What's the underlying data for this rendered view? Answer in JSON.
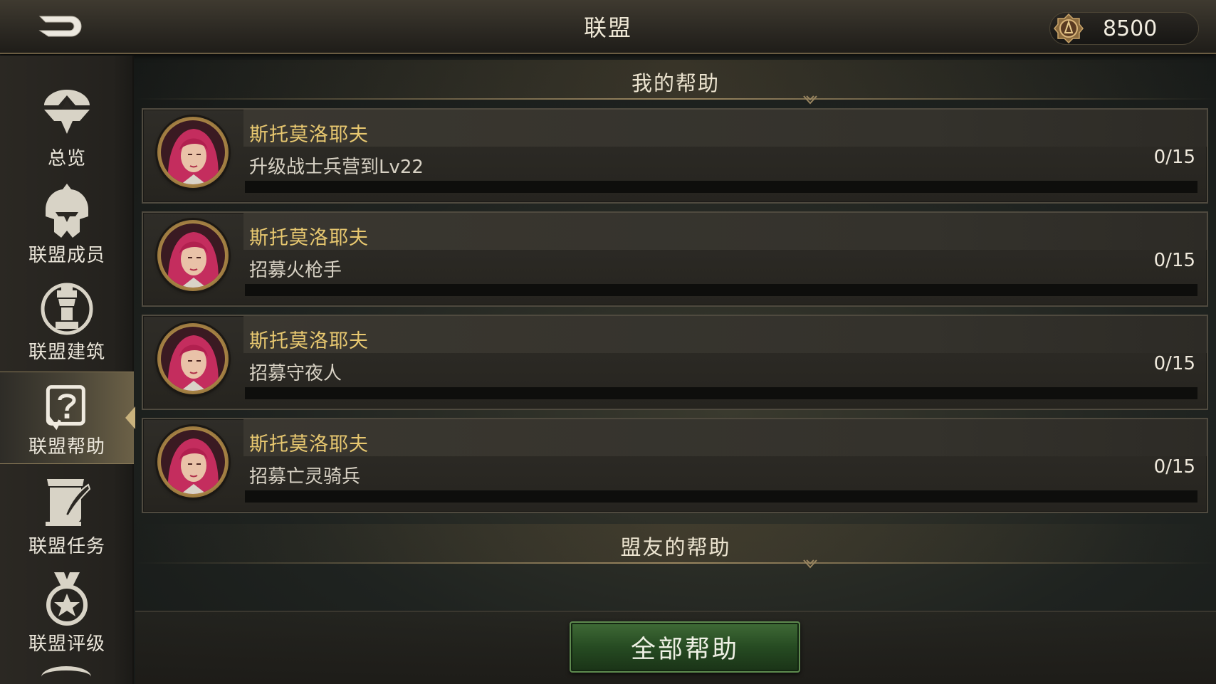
{
  "header": {
    "title": "联盟",
    "currency_amount": "8500"
  },
  "sidebar": {
    "items": [
      {
        "label": "总览",
        "icon": "overview-icon"
      },
      {
        "label": "联盟成员",
        "icon": "helmet-icon"
      },
      {
        "label": "联盟建筑",
        "icon": "chess-castle-icon"
      },
      {
        "label": "联盟帮助",
        "icon": "help-question-icon",
        "active": true
      },
      {
        "label": "联盟任务",
        "icon": "scroll-quill-icon"
      },
      {
        "label": "联盟评级",
        "icon": "medal-star-icon"
      }
    ]
  },
  "my_help": {
    "header": "我的帮助",
    "requests": [
      {
        "name": "斯托莫洛耶夫",
        "task": "升级战士兵营到Lv22",
        "count": "0/15",
        "progress": 0
      },
      {
        "name": "斯托莫洛耶夫",
        "task": "招募火枪手",
        "count": "0/15",
        "progress": 0
      },
      {
        "name": "斯托莫洛耶夫",
        "task": "招募守夜人",
        "count": "0/15",
        "progress": 0
      },
      {
        "name": "斯托莫洛耶夫",
        "task": "招募亡灵骑兵",
        "count": "0/15",
        "progress": 0
      }
    ]
  },
  "ally_help": {
    "header": "盟友的帮助"
  },
  "footer": {
    "help_all_label": "全部帮助"
  },
  "colors": {
    "name_gold": "#e8c870",
    "button_green": "#264b22",
    "progress_track": "#0e0e0c"
  }
}
